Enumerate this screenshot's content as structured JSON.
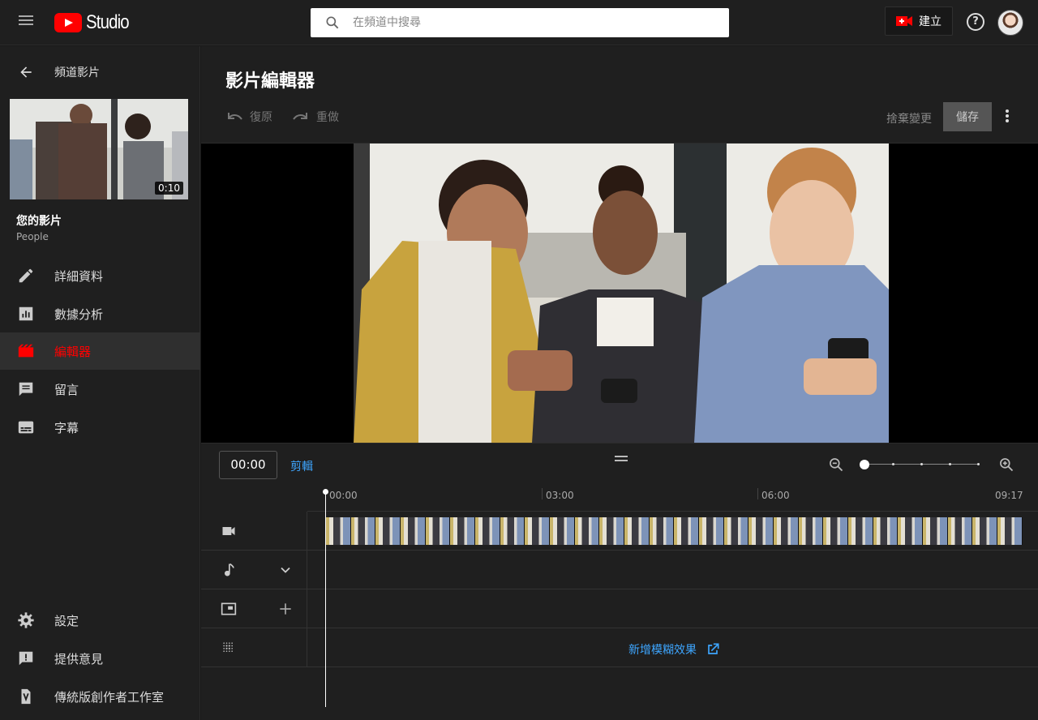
{
  "topbar": {
    "logo_text": "Studio",
    "search_placeholder": "在頻道中搜尋",
    "create_label": "建立",
    "help_symbol": "?"
  },
  "sidebar": {
    "back_label": "頻道影片",
    "thumbnail_duration": "0:10",
    "video_title": "您的影片",
    "channel_name": "People",
    "items": [
      {
        "label": "詳細資料",
        "icon": "pencil-icon"
      },
      {
        "label": "數據分析",
        "icon": "analytics-icon"
      },
      {
        "label": "編輯器",
        "icon": "editor-icon",
        "active": true
      },
      {
        "label": "留言",
        "icon": "comments-icon"
      },
      {
        "label": "字幕",
        "icon": "subtitles-icon"
      }
    ],
    "bottom_items": [
      {
        "label": "設定",
        "icon": "gear-icon"
      },
      {
        "label": "提供意見",
        "icon": "feedback-icon"
      },
      {
        "label": "傳統版創作者工作室",
        "icon": "classic-studio-icon"
      }
    ]
  },
  "editor": {
    "title": "影片編輯器",
    "undo_label": "復原",
    "redo_label": "重做",
    "discard_label": "捨棄變更",
    "save_label": "儲存"
  },
  "timeline": {
    "timecode": "00:00",
    "trim_label": "剪輯",
    "ruler": [
      "00:00",
      "03:00",
      "06:00",
      "09:17"
    ],
    "blur_label": "新增模糊效果",
    "zoom_level": 0,
    "accent_color": "#3ea6ff",
    "active_color": "#ff0000"
  }
}
